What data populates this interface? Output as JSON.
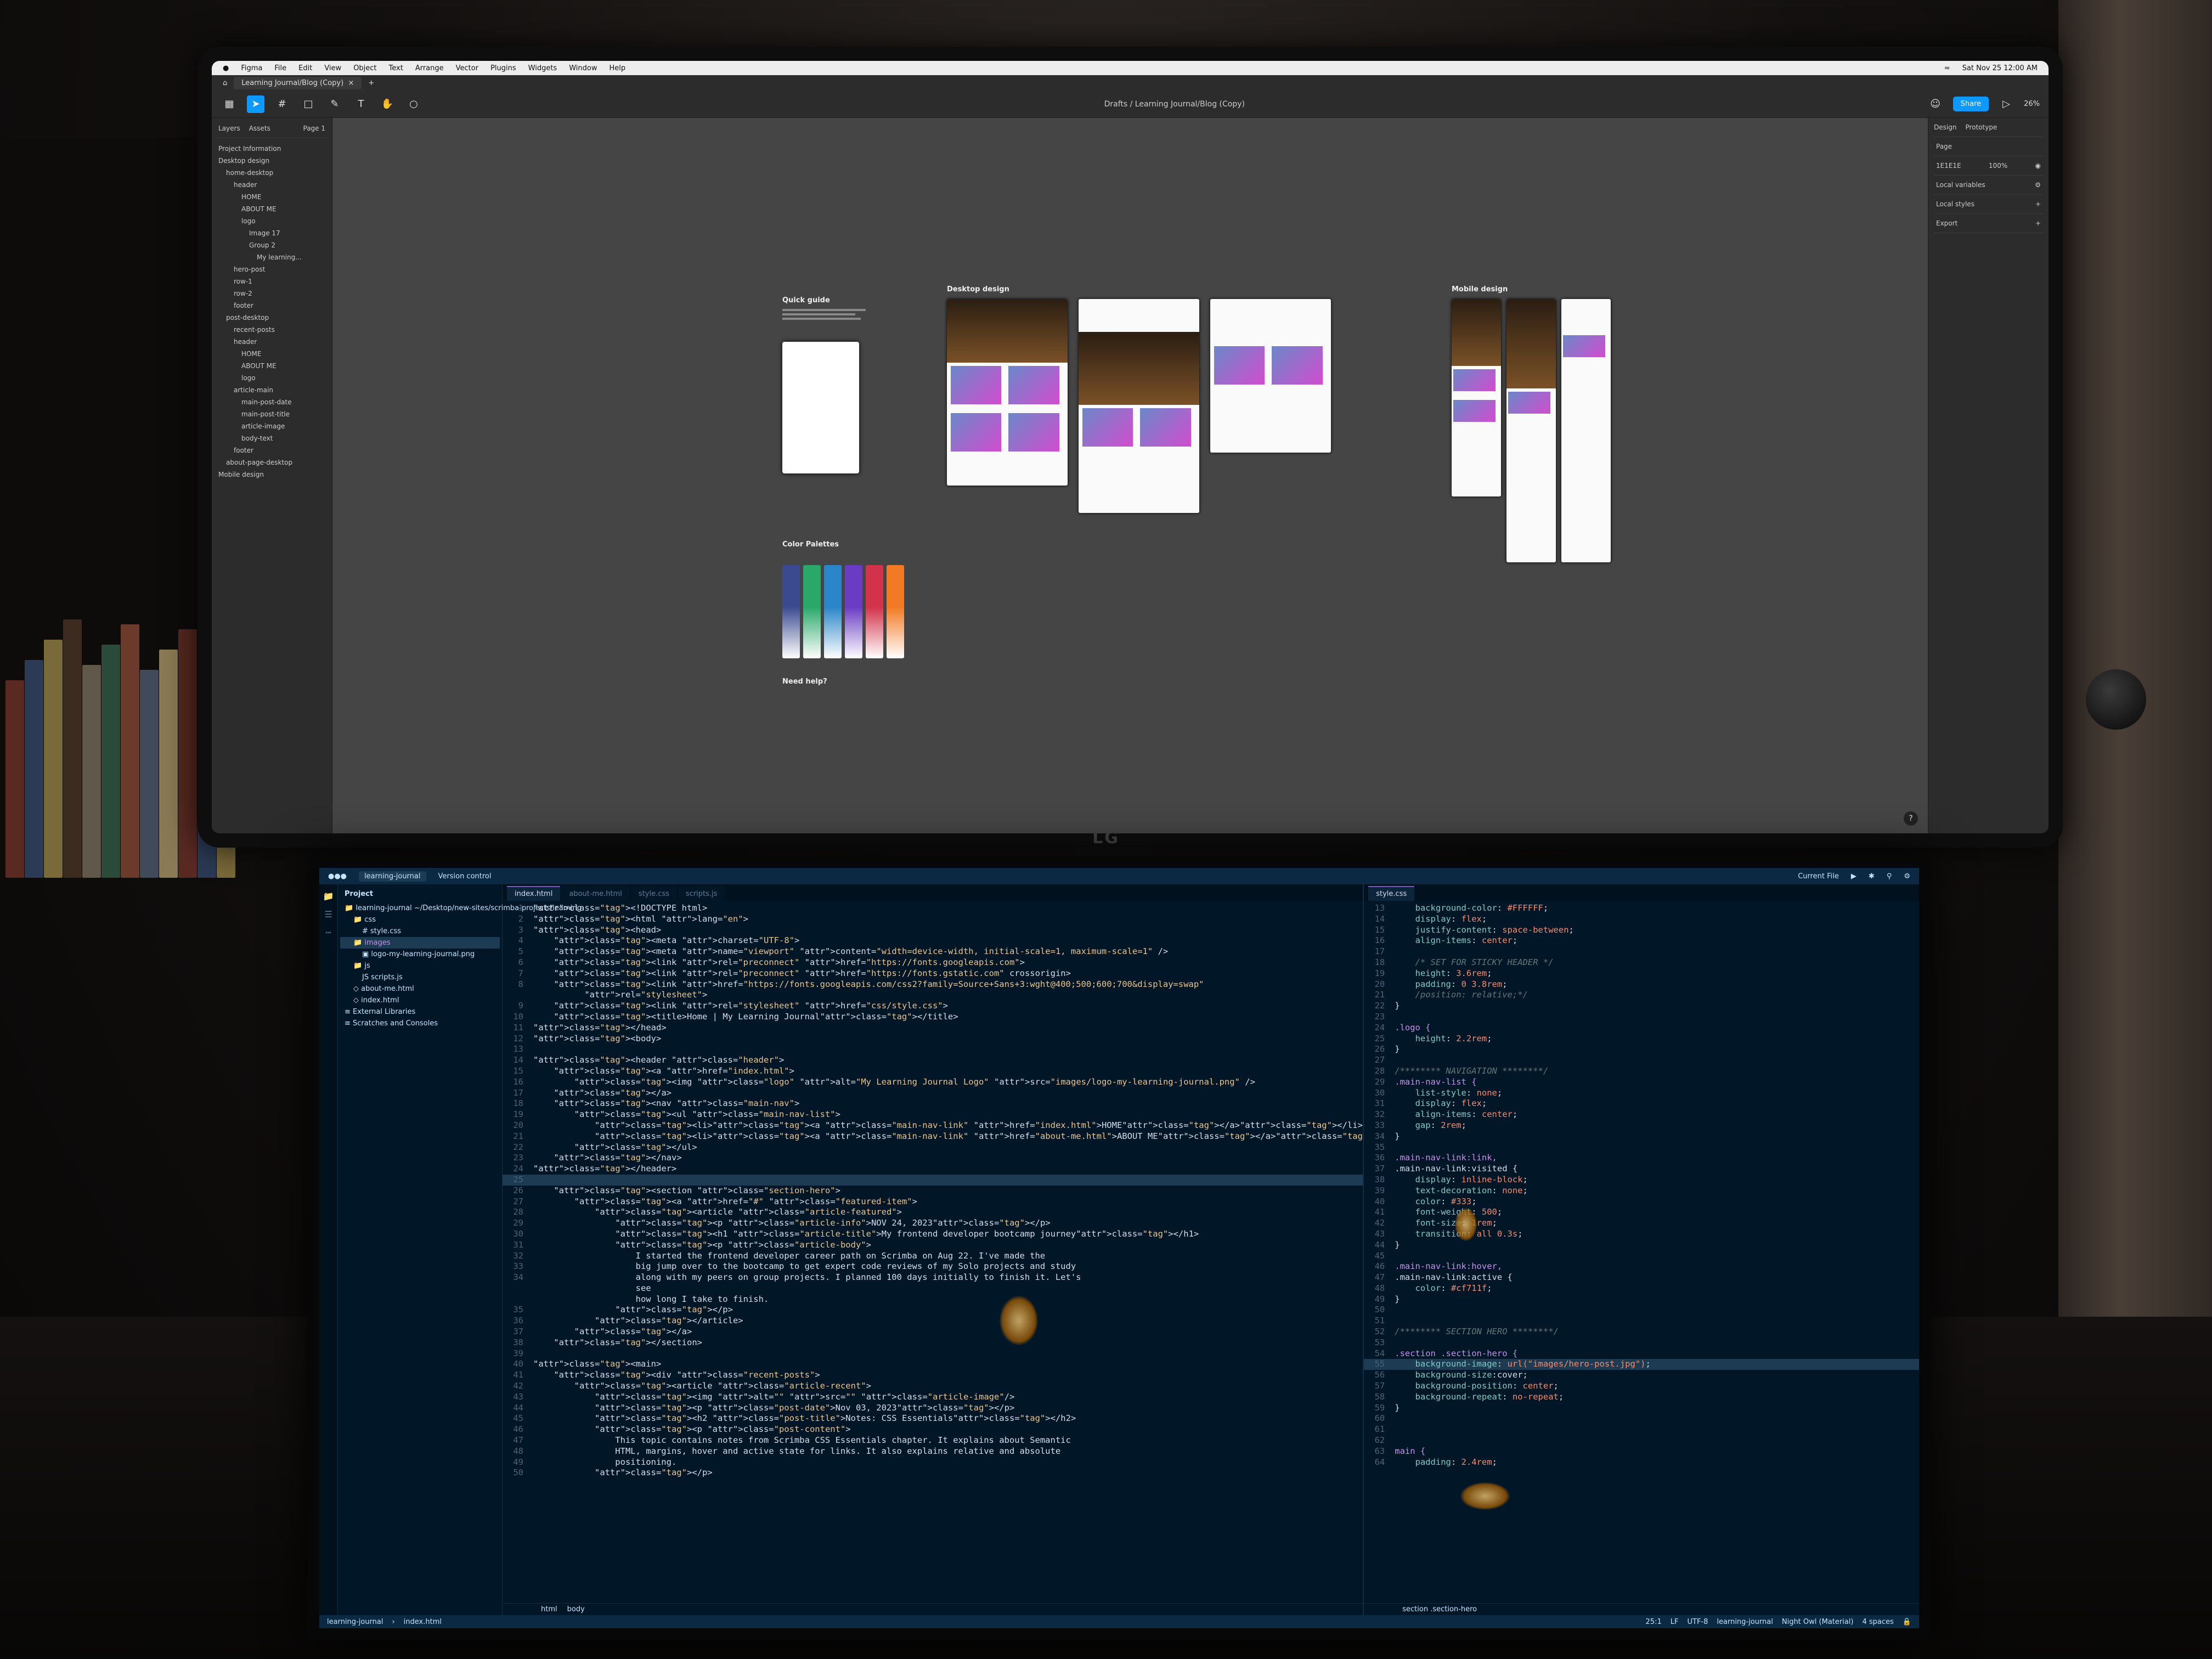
{
  "figma": {
    "menubar": [
      "Figma",
      "File",
      "Edit",
      "View",
      "Object",
      "Text",
      "Arrange",
      "Vector",
      "Plugins",
      "Widgets",
      "Window",
      "Help"
    ],
    "clock": "Sat Nov 25  12:00 AM",
    "tab": "Learning Journal/Blog (Copy)",
    "breadcrumb": "Drafts  /  Learning Journal/Blog (Copy)",
    "share": "Share",
    "zoom": "26%",
    "left_tabs": [
      "Layers",
      "Assets"
    ],
    "page": "Page 1",
    "layers": [
      "Project Information",
      "Desktop design",
      "home-desktop",
      "header",
      "HOME",
      "ABOUT ME",
      "logo",
      "Image 17",
      "Group 2",
      "My learning...",
      "hero-post",
      "row-1",
      "row-2",
      "footer",
      "post-desktop",
      "recent-posts",
      "header",
      "HOME",
      "ABOUT ME",
      "logo",
      "article-main",
      "main-post-date",
      "main-post-title",
      "article-image",
      "body-text",
      "footer",
      "about-page-desktop",
      "Mobile design"
    ],
    "right_tabs": [
      "Design",
      "Prototype"
    ],
    "right_rows": [
      "Page",
      "Local variables",
      "Local styles",
      "Export"
    ],
    "page_color": "1E1E1E",
    "page_opacity": "100%",
    "canvas": {
      "quick_guide_title": "Quick guide",
      "desktop_label": "Desktop design",
      "mobile_label": "Mobile design",
      "palette_title": "Color Palettes",
      "help_title": "Need help?",
      "swatch_colors": [
        "#3b4a8f",
        "#2aa86a",
        "#2a86c9",
        "#6a3cc4",
        "#d2334a",
        "#f27a24"
      ]
    },
    "monitor_brand": "LG"
  },
  "ide": {
    "project_name": "learning-journal",
    "vcs": "Version control",
    "run_config": "Current File",
    "project_label": "Project",
    "tree": [
      "learning-journal  ~/Desktop/new-sites/scrimba-projects/learning",
      "css",
      "style.css",
      "images",
      "logo-my-learning-journal.png",
      "js",
      "scripts.js",
      "about-me.html",
      "index.html",
      "External Libraries",
      "Scratches and Consoles"
    ],
    "tabs": [
      "index.html",
      "about-me.html",
      "style.css",
      "scripts.js"
    ],
    "css_tab": "style.css",
    "html_lines": [
      {
        "n": "1",
        "t": "<!DOCTYPE html>"
      },
      {
        "n": "2",
        "t": "<html lang=\"en\">"
      },
      {
        "n": "3",
        "t": "<head>"
      },
      {
        "n": "4",
        "t": "    <meta charset=\"UTF-8\">"
      },
      {
        "n": "5",
        "t": "    <meta name=\"viewport\" content=\"width=device-width, initial-scale=1, maximum-scale=1\" />"
      },
      {
        "n": "6",
        "t": "    <link rel=\"preconnect\" href=\"https://fonts.googleapis.com\">"
      },
      {
        "n": "7",
        "t": "    <link rel=\"preconnect\" href=\"https://fonts.gstatic.com\" crossorigin>"
      },
      {
        "n": "8",
        "t": "    <link href=\"https://fonts.googleapis.com/css2?family=Source+Sans+3:wght@400;500;600;700&display=swap\""
      },
      {
        "n": "",
        "t": "          rel=\"stylesheet\">"
      },
      {
        "n": "9",
        "t": "    <link rel=\"stylesheet\" href=\"css/style.css\">"
      },
      {
        "n": "10",
        "t": "    <title>Home | My Learning Journal</title>"
      },
      {
        "n": "11",
        "t": "</head>"
      },
      {
        "n": "12",
        "t": "<body>"
      },
      {
        "n": "13",
        "t": ""
      },
      {
        "n": "14",
        "t": "<header class=\"header\">"
      },
      {
        "n": "15",
        "t": "    <a href=\"index.html\">"
      },
      {
        "n": "16",
        "t": "        <img class=\"logo\" alt=\"My Learning Journal Logo\" src=\"images/logo-my-learning-journal.png\" />"
      },
      {
        "n": "17",
        "t": "    </a>"
      },
      {
        "n": "18",
        "t": "    <nav class=\"main-nav\">"
      },
      {
        "n": "19",
        "t": "        <ul class=\"main-nav-list\">"
      },
      {
        "n": "20",
        "t": "            <li><a class=\"main-nav-link\" href=\"index.html\">HOME</a></li>"
      },
      {
        "n": "21",
        "t": "            <li><a class=\"main-nav-link\" href=\"about-me.html\">ABOUT ME</a></li>"
      },
      {
        "n": "22",
        "t": "        </ul>"
      },
      {
        "n": "23",
        "t": "    </nav>"
      },
      {
        "n": "24",
        "t": "</header>"
      },
      {
        "n": "25",
        "t": "",
        "hl": true
      },
      {
        "n": "26",
        "t": "    <section class=\"section-hero\">"
      },
      {
        "n": "27",
        "t": "        <a href=\"#\" class=\"featured-item\">"
      },
      {
        "n": "28",
        "t": "            <article class=\"article-featured\">"
      },
      {
        "n": "29",
        "t": "                <p class=\"article-info\">NOV 24, 2023</p>"
      },
      {
        "n": "30",
        "t": "                <h1 class=\"article-title\">My frontend developer bootcamp journey</h1>"
      },
      {
        "n": "31",
        "t": "                <p class=\"article-body\">"
      },
      {
        "n": "32",
        "t": "                    I started the frontend developer career path on Scrimba on Aug 22. I've made the"
      },
      {
        "n": "33",
        "t": "                    big jump over to the bootcamp to get expert code reviews of my Solo projects and study"
      },
      {
        "n": "34",
        "t": "                    along with my peers on group projects. I planned 100 days initially to finish it. Let's"
      },
      {
        "n": "",
        "t": "                    see"
      },
      {
        "n": "",
        "t": "                    how long I take to finish."
      },
      {
        "n": "35",
        "t": "                </p>"
      },
      {
        "n": "36",
        "t": "            </article>"
      },
      {
        "n": "37",
        "t": "        </a>"
      },
      {
        "n": "38",
        "t": "    </section>"
      },
      {
        "n": "39",
        "t": ""
      },
      {
        "n": "40",
        "t": "<main>"
      },
      {
        "n": "41",
        "t": "    <div class=\"recent-posts\">"
      },
      {
        "n": "42",
        "t": "        <article class=\"article-recent\">"
      },
      {
        "n": "43",
        "t": "            <img alt=\"\" src=\"\" class=\"article-image\"/>"
      },
      {
        "n": "44",
        "t": "            <p class=\"post-date\">Nov 03, 2023</p>"
      },
      {
        "n": "45",
        "t": "            <h2 class=\"post-title\">Notes: CSS Essentials</h2>"
      },
      {
        "n": "46",
        "t": "            <p class=\"post-content\">"
      },
      {
        "n": "47",
        "t": "                This topic contains notes from Scrimba CSS Essentials chapter. It explains about Semantic"
      },
      {
        "n": "48",
        "t": "                HTML, margins, hover and active state for links. It also explains relative and absolute"
      },
      {
        "n": "49",
        "t": "                positioning."
      },
      {
        "n": "50",
        "t": "            </p>"
      }
    ],
    "css_lines": [
      {
        "n": "13",
        "t": "    background-color: #FFFFFF;"
      },
      {
        "n": "14",
        "t": "    display: flex;"
      },
      {
        "n": "15",
        "t": "    justify-content: space-between;"
      },
      {
        "n": "16",
        "t": "    align-items: center;"
      },
      {
        "n": "17",
        "t": ""
      },
      {
        "n": "18",
        "t": "    /* SET FOR STICKY HEADER */"
      },
      {
        "n": "19",
        "t": "    height: 3.6rem;"
      },
      {
        "n": "20",
        "t": "    padding: 0 3.8rem;"
      },
      {
        "n": "21",
        "t": "    /position: relative;*/"
      },
      {
        "n": "22",
        "t": "}"
      },
      {
        "n": "23",
        "t": ""
      },
      {
        "n": "24",
        "t": ".logo {"
      },
      {
        "n": "25",
        "t": "    height: 2.2rem;"
      },
      {
        "n": "26",
        "t": "}"
      },
      {
        "n": "27",
        "t": ""
      },
      {
        "n": "28",
        "t": "/******** NAVIGATION ********/"
      },
      {
        "n": "29",
        "t": ".main-nav-list {"
      },
      {
        "n": "30",
        "t": "    list-style: none;"
      },
      {
        "n": "31",
        "t": "    display: flex;"
      },
      {
        "n": "32",
        "t": "    align-items: center;"
      },
      {
        "n": "33",
        "t": "    gap: 2rem;"
      },
      {
        "n": "34",
        "t": "}"
      },
      {
        "n": "35",
        "t": ""
      },
      {
        "n": "36",
        "t": ".main-nav-link:link,"
      },
      {
        "n": "37",
        "t": ".main-nav-link:visited {"
      },
      {
        "n": "38",
        "t": "    display: inline-block;"
      },
      {
        "n": "39",
        "t": "    text-decoration: none;"
      },
      {
        "n": "40",
        "t": "    color: #333;"
      },
      {
        "n": "41",
        "t": "    font-weight: 500;"
      },
      {
        "n": "42",
        "t": "    font-size: 1rem;"
      },
      {
        "n": "43",
        "t": "    transition: all 0.3s;"
      },
      {
        "n": "44",
        "t": "}"
      },
      {
        "n": "45",
        "t": ""
      },
      {
        "n": "46",
        "t": ".main-nav-link:hover,"
      },
      {
        "n": "47",
        "t": ".main-nav-link:active {"
      },
      {
        "n": "48",
        "t": "    color: #cf711f;"
      },
      {
        "n": "49",
        "t": "}"
      },
      {
        "n": "50",
        "t": ""
      },
      {
        "n": "51",
        "t": ""
      },
      {
        "n": "52",
        "t": "/******** SECTION HERO ********/"
      },
      {
        "n": "53",
        "t": ""
      },
      {
        "n": "54",
        "t": ".section .section-hero {"
      },
      {
        "n": "55",
        "t": "    background-image: url(\"images/hero-post.jpg\");",
        "hl": true
      },
      {
        "n": "56",
        "t": "    background-size:cover;"
      },
      {
        "n": "57",
        "t": "    background-position: center;"
      },
      {
        "n": "58",
        "t": "    background-repeat: no-repeat;"
      },
      {
        "n": "59",
        "t": "}"
      },
      {
        "n": "60",
        "t": ""
      },
      {
        "n": "61",
        "t": ""
      },
      {
        "n": "62",
        "t": ""
      },
      {
        "n": "63",
        "t": "main {"
      },
      {
        "n": "64",
        "t": "    padding: 2.4rem;"
      }
    ],
    "html_crumbs": [
      "html",
      "body"
    ],
    "css_crumb": "section .section-hero",
    "status": {
      "project": "learning-journal",
      "file": "index.html",
      "position": "25:1",
      "line_sep": "LF",
      "encoding": "UTF-8",
      "theme": "Night Owl (Material)",
      "indent": "4 spaces"
    }
  }
}
